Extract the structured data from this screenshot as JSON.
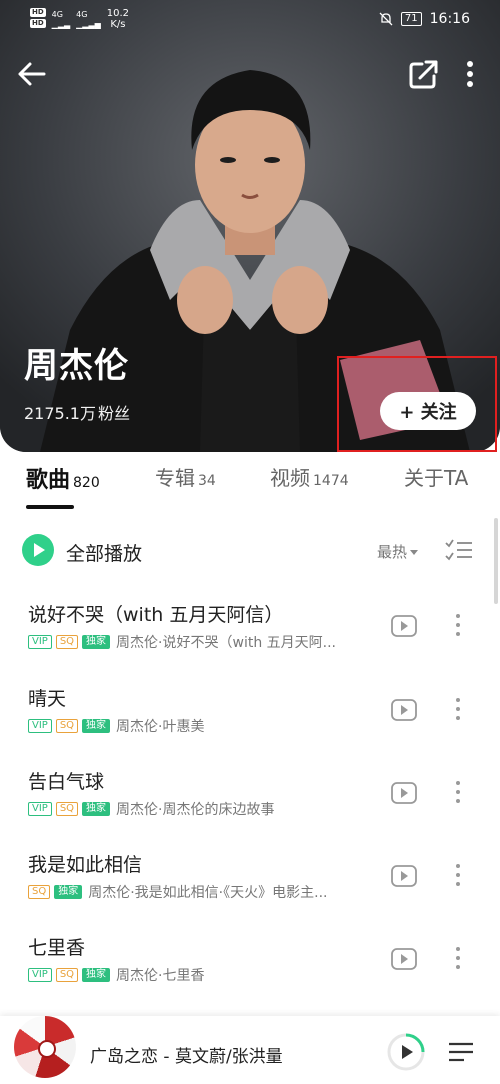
{
  "status_bar": {
    "hd1": "HD",
    "hd2": "HD",
    "signal1": "4G",
    "signal2": "4G",
    "speed_value": "10.2",
    "speed_unit": "K/s",
    "battery": "71",
    "time": "16:16"
  },
  "artist": {
    "name": "周杰伦",
    "fans_count": "2175.1万",
    "fans_unit": "粉丝",
    "follow_label": "+ 关注"
  },
  "tabs": [
    {
      "label": "歌曲",
      "count": "820"
    },
    {
      "label": "专辑",
      "count": "34"
    },
    {
      "label": "视频",
      "count": "1474"
    },
    {
      "label": "关于TA",
      "count": ""
    }
  ],
  "play_all": {
    "label": "全部播放",
    "sort_label": "最热"
  },
  "songs": [
    {
      "title": "说好不哭（with 五月天阿信）",
      "badges": [
        "VIP",
        "SQ",
        "独家"
      ],
      "subtitle": "周杰伦·说好不哭（with 五月天阿..."
    },
    {
      "title": "晴天",
      "badges": [
        "VIP",
        "SQ",
        "独家"
      ],
      "subtitle": "周杰伦·叶惠美"
    },
    {
      "title": "告白气球",
      "badges": [
        "VIP",
        "SQ",
        "独家"
      ],
      "subtitle": "周杰伦·周杰伦的床边故事"
    },
    {
      "title": "我是如此相信",
      "badges": [
        "SQ",
        "独家"
      ],
      "subtitle": "周杰伦·我是如此相信·《天火》电影主..."
    },
    {
      "title": "七里香",
      "badges": [
        "VIP",
        "SQ",
        "独家"
      ],
      "subtitle": "周杰伦·七里香"
    }
  ],
  "mini_player": {
    "now_playing": "广岛之恋 - 莫文蔚/张洪量"
  },
  "colors": {
    "accent_green": "#2fd08a",
    "sq_orange": "#e9a23b",
    "highlight_red": "#e02020"
  }
}
